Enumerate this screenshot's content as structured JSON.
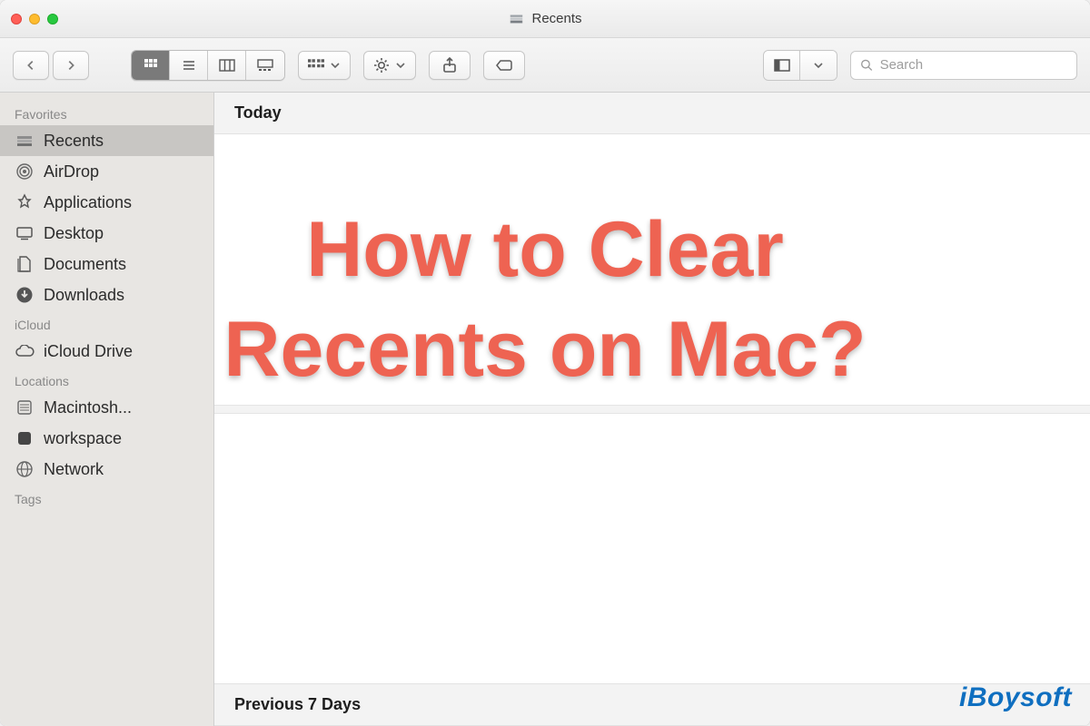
{
  "window": {
    "title": "Recents"
  },
  "toolbar": {
    "search_placeholder": "Search"
  },
  "sidebar": {
    "sections": [
      {
        "title": "Favorites",
        "items": [
          {
            "label": "Recents",
            "icon": "recents-icon",
            "selected": true
          },
          {
            "label": "AirDrop",
            "icon": "airdrop-icon"
          },
          {
            "label": "Applications",
            "icon": "applications-icon"
          },
          {
            "label": "Desktop",
            "icon": "desktop-icon"
          },
          {
            "label": "Documents",
            "icon": "documents-icon"
          },
          {
            "label": "Downloads",
            "icon": "downloads-icon",
            "partially_covered_label": "Dow"
          }
        ]
      },
      {
        "title": "iCloud",
        "items": [
          {
            "label": "iCloud Drive",
            "icon": "icloud-icon"
          }
        ]
      },
      {
        "title": "Locations",
        "items": [
          {
            "label": "Macintosh...",
            "icon": "disk-icon"
          },
          {
            "label": "workspace",
            "icon": "volume-dark-icon"
          },
          {
            "label": "Network",
            "icon": "network-icon"
          }
        ]
      },
      {
        "title": "Tags",
        "items": []
      }
    ]
  },
  "content": {
    "sections": [
      {
        "heading": "Today"
      },
      {
        "heading": "Previous 7 Days"
      }
    ]
  },
  "overlay": {
    "headline_line1": "How to Clear",
    "headline_line2": "Recents on Mac?",
    "watermark_text": "iBoysoft"
  }
}
